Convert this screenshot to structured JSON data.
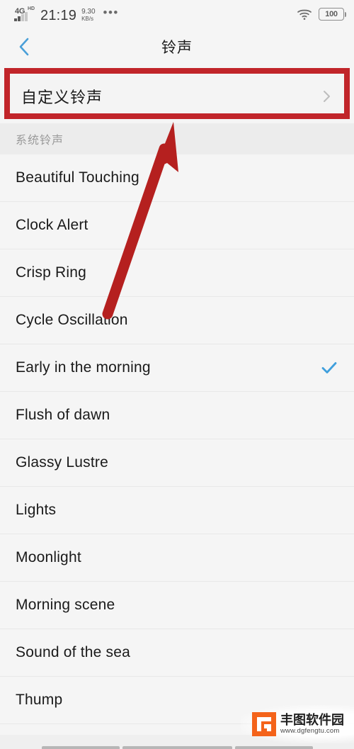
{
  "status_bar": {
    "network_type": "4G",
    "network_suffix": "HD",
    "time": "21:19",
    "net_speed_value": "9.30",
    "net_speed_unit": "KB/s",
    "overflow_dots": "•••",
    "wifi_icon": "wifi-icon",
    "battery_level": "100"
  },
  "app_bar": {
    "back_icon": "chevron-left-icon",
    "title": "铃声",
    "back_color": "#4a9fd8"
  },
  "custom_row": {
    "label": "自定义铃声",
    "chevron_icon": "chevron-right-icon",
    "highlight_color": "#c1252a"
  },
  "section": {
    "header": "系统铃声"
  },
  "ringtones": [
    {
      "name": "Beautiful Touching",
      "selected": false
    },
    {
      "name": "Clock Alert",
      "selected": false
    },
    {
      "name": "Crisp Ring",
      "selected": false
    },
    {
      "name": "Cycle Oscillation",
      "selected": false
    },
    {
      "name": "Early in the morning",
      "selected": true
    },
    {
      "name": "Flush of dawn",
      "selected": false
    },
    {
      "name": "Glassy Lustre",
      "selected": false
    },
    {
      "name": "Lights",
      "selected": false
    },
    {
      "name": "Moonlight",
      "selected": false
    },
    {
      "name": "Morning scene",
      "selected": false
    },
    {
      "name": "Sound of the sea",
      "selected": false
    },
    {
      "name": "Thump",
      "selected": false
    }
  ],
  "selection": {
    "check_icon": "check-icon",
    "check_color": "#3f9fdd"
  },
  "annotation": {
    "arrow_icon": "arrow-up-right-icon",
    "arrow_color": "#b5201f"
  },
  "watermark": {
    "logo_icon": "fengtu-logo-icon",
    "title": "丰图软件园",
    "url": "www.dgfengtu.com",
    "logo_color": "#f4631a"
  },
  "nav_bar": {
    "icon": "gesture-nav-bar"
  }
}
